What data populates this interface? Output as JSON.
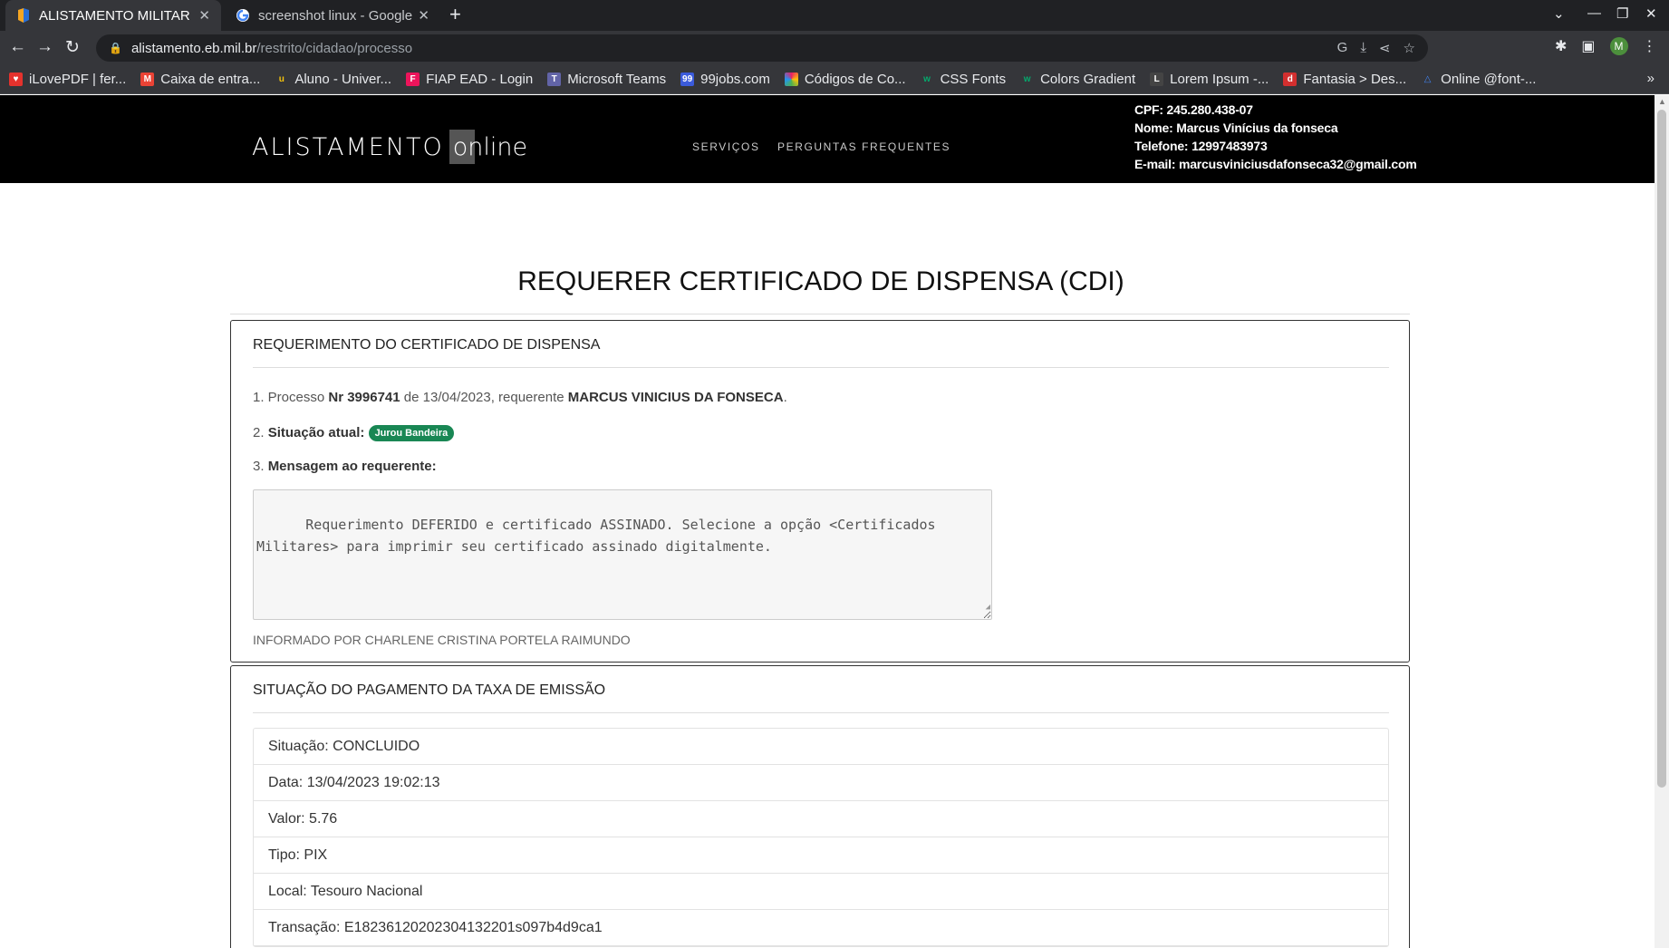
{
  "browser": {
    "tabs": [
      {
        "title": "ALISTAMENTO MILITAR C",
        "active": true
      },
      {
        "title": "screenshot linux - Google",
        "active": false
      }
    ],
    "url_host": "alistamento.eb.mil.br",
    "url_path": "/restrito/cidadao/processo",
    "avatar_letter": "M",
    "bookmarks": [
      {
        "label": "iLovePDF | fer...",
        "icon": "heart-icon",
        "color": "#e5322d"
      },
      {
        "label": "Caixa de entra...",
        "icon": "gmail-icon",
        "color": "#ea4335"
      },
      {
        "label": "Aluno - Univer...",
        "icon": "u-icon",
        "color": "#f4c20d"
      },
      {
        "label": "FIAP EAD - Login",
        "icon": "fiap-icon",
        "color": "#ed145b"
      },
      {
        "label": "Microsoft Teams",
        "icon": "teams-icon",
        "color": "#6264a7"
      },
      {
        "label": "99jobs.com",
        "icon": "99jobs-icon",
        "color": "#3b5bdb"
      },
      {
        "label": "Códigos de Co...",
        "icon": "palette-icon",
        "color": "#e91e63"
      },
      {
        "label": "CSS Fonts",
        "icon": "w3-icon",
        "color": "#04aa6d"
      },
      {
        "label": "Colors Gradient",
        "icon": "w3-icon",
        "color": "#04aa6d"
      },
      {
        "label": "Lorem Ipsum -...",
        "icon": "lorem-icon",
        "color": "#444444"
      },
      {
        "label": "Fantasia > Des...",
        "icon": "dafont-icon",
        "color": "#d32f2f"
      },
      {
        "label": "Online @font-...",
        "icon": "triangle-icon",
        "color": "#4285f4"
      }
    ]
  },
  "site": {
    "logo_main": "ALISTAMENTO",
    "logo_sub": "online",
    "menu": [
      "SERVIÇOS",
      "PERGUNTAS FREQUENTES"
    ],
    "user": {
      "cpf": "CPF: 245.280.438-07",
      "nome": "Nome: Marcus Vinícius da fonseca",
      "telefone": "Telefone: 12997483973",
      "email": "E-mail: marcusviniciusdafonseca32@gmail.com"
    }
  },
  "main": {
    "title": "REQUERER CERTIFICADO DE DISPENSA (CDI)",
    "requerimento": {
      "heading": "REQUERIMENTO DO CERTIFICADO DE DISPENSA",
      "l1_prefix": "1. Processo ",
      "l1_nr": "Nr 3996741",
      "l1_mid": " de 13/04/2023, requerente ",
      "l1_name": "MARCUS VINICIUS DA FONSECA",
      "l1_end": ".",
      "l2_prefix": "2. ",
      "l2_label": "Situação atual:",
      "l2_badge": "Jurou Bandeira",
      "l3_prefix": "3. ",
      "l3_label": "Mensagem ao requerente:",
      "message": "Requerimento DEFERIDO e certificado ASSINADO. Selecione a opção <Certificados\nMilitares> para imprimir seu certificado assinado digitalmente.",
      "informado": "INFORMADO POR CHARLENE CRISTINA PORTELA RAIMUNDO"
    },
    "pagamento": {
      "heading": "SITUAÇÃO DO PAGAMENTO DA TAXA DE EMISSÃO",
      "rows": [
        "Situação: CONCLUIDO",
        "Data: 13/04/2023 19:02:13",
        "Valor: 5.76",
        "Tipo: PIX",
        "Local: Tesouro Nacional",
        "Transação: E18236120202304132201s097b4d9ca1"
      ]
    }
  }
}
